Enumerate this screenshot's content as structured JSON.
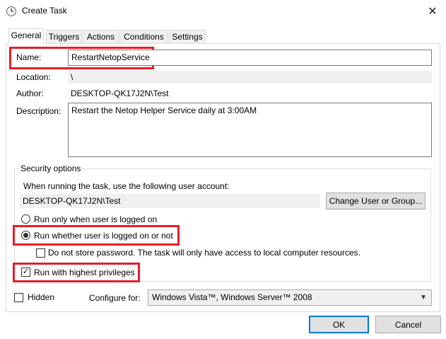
{
  "window": {
    "title": "Create Task"
  },
  "tabs": [
    {
      "label": "General"
    },
    {
      "label": "Triggers"
    },
    {
      "label": "Actions"
    },
    {
      "label": "Conditions"
    },
    {
      "label": "Settings"
    }
  ],
  "general": {
    "name_label": "Name:",
    "name_value": "RestartNetopService",
    "location_label": "Location:",
    "location_value": "\\",
    "author_label": "Author:",
    "author_value": "DESKTOP-QK17J2N\\Test",
    "description_label": "Description:",
    "description_value": "Restart the Netop Helper Service daily at 3:00AM"
  },
  "security": {
    "title": "Security options",
    "account_prompt": "When running the task, use the following user account:",
    "account_value": "DESKTOP-QK17J2N\\Test",
    "change_button": "Change User or Group...",
    "radio_logged_on": "Run only when user is logged on",
    "radio_whether": "Run whether user is logged on or not",
    "do_not_store": "Do not store password.  The task will only have access to local computer resources.",
    "highest_privileges": "Run with highest privileges",
    "selected_radio": "whether",
    "highest_privileges_checked": true,
    "do_not_store_checked": false
  },
  "footer": {
    "hidden_label": "Hidden",
    "hidden_checked": false,
    "configure_label": "Configure for:",
    "configure_value": "Windows Vista™, Windows Server™ 2008",
    "ok_button": "OK",
    "cancel_button": "Cancel"
  },
  "colors": {
    "highlight": "#e0202a",
    "accent": "#0078d7"
  },
  "icons": {
    "window_icon": "clock-icon",
    "close": "close-icon",
    "dropdown": "chevron-down-icon"
  }
}
